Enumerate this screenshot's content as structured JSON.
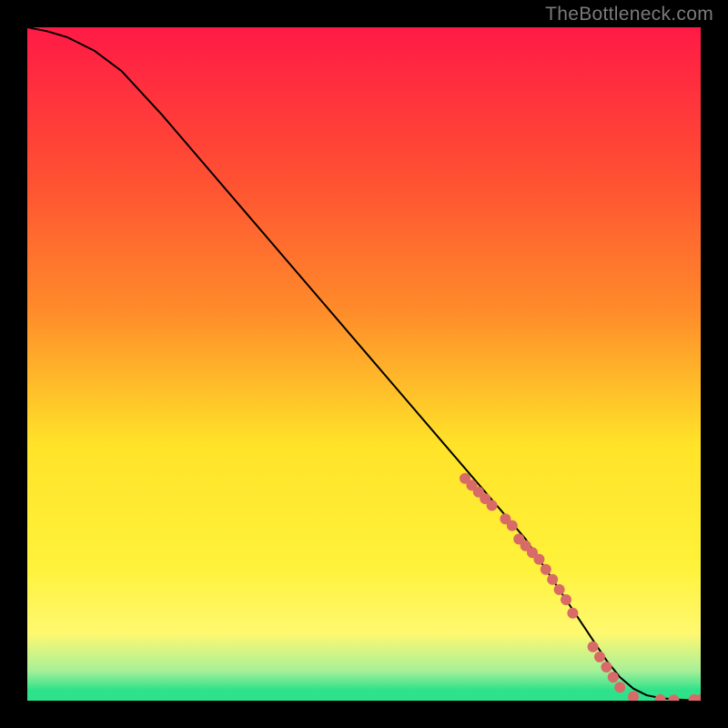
{
  "watermark": "TheBottleneck.com",
  "colors": {
    "page_bg": "#000000",
    "gradient_top": "#ff1a46",
    "gradient_mid1": "#ff8b2a",
    "gradient_mid2": "#ffe329",
    "gradient_mid3": "#fff970",
    "gradient_mid4": "#a8f098",
    "gradient_bottom": "#2de28a",
    "curve": "#000000",
    "marker": "#d86a68"
  },
  "chart_data": {
    "type": "line",
    "title": "",
    "xlabel": "",
    "ylabel": "",
    "xlim": [
      0,
      100
    ],
    "ylim": [
      0,
      100
    ],
    "grid": false,
    "legend": false,
    "series": [
      {
        "name": "bottleneck-curve",
        "x": [
          0,
          3,
          6,
          10,
          14,
          20,
          26,
          32,
          38,
          44,
          50,
          56,
          62,
          68,
          74,
          80,
          82,
          84,
          86,
          88,
          90,
          92,
          94,
          96,
          98,
          100
        ],
        "y": [
          100,
          99.4,
          98.5,
          96.5,
          93.5,
          87,
          80,
          73,
          66,
          59,
          52,
          45,
          38,
          31,
          24,
          15,
          12,
          9,
          6,
          3.5,
          1.8,
          0.8,
          0.4,
          0.2,
          0.1,
          0.1
        ]
      },
      {
        "name": "bottleneck-markers",
        "x": [
          65,
          66,
          67,
          68,
          69,
          71,
          72,
          73,
          74,
          75,
          76,
          77,
          78,
          79,
          80,
          81,
          84,
          85,
          86,
          87,
          88,
          90,
          94,
          96,
          99,
          100
        ],
        "y": [
          33,
          32,
          31,
          30,
          29,
          27,
          26,
          24,
          23,
          22,
          21,
          19.5,
          18,
          16.5,
          15,
          13,
          8,
          6.5,
          5,
          3.5,
          2,
          0.6,
          0.15,
          0.1,
          0.15,
          0.15
        ]
      }
    ]
  }
}
